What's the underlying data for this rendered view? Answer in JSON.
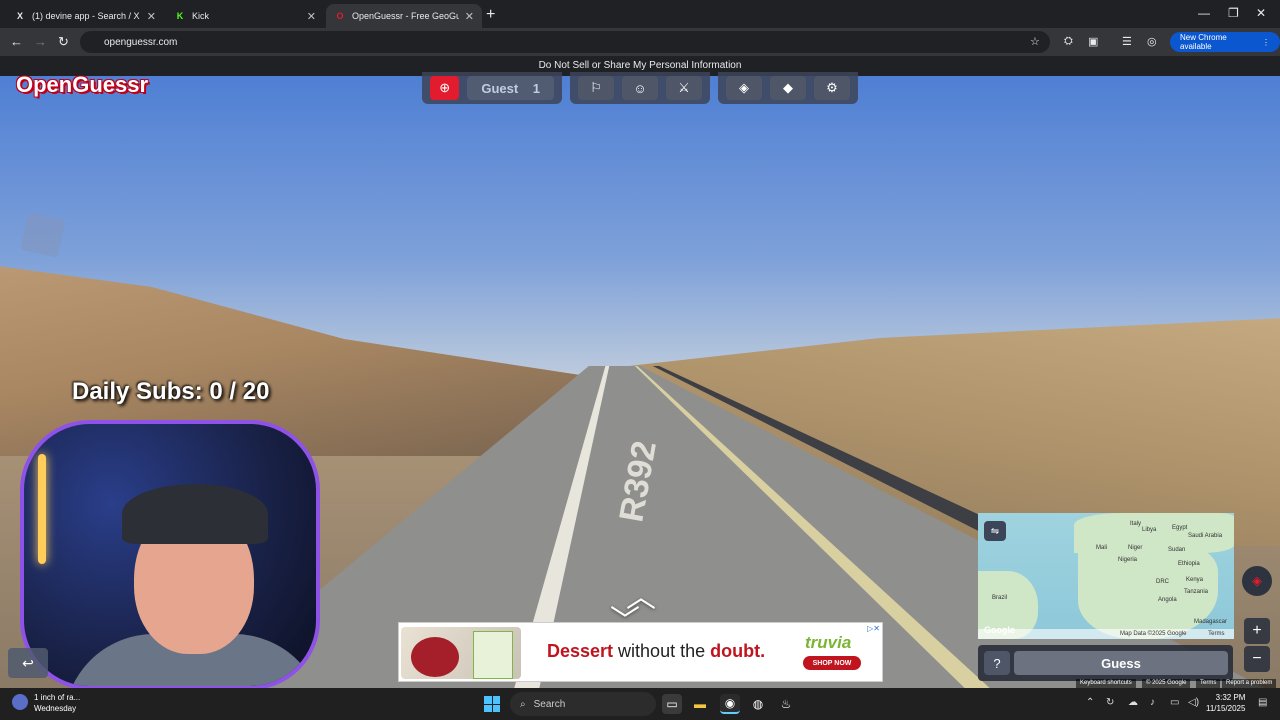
{
  "tabs": [
    {
      "icon": "X",
      "title": "(1) devine app - Search / X",
      "active": false
    },
    {
      "icon": "K",
      "title": "Kick",
      "active": false
    },
    {
      "icon": "O",
      "title": "OpenGuessr - Free GeoGuessr...",
      "active": true
    }
  ],
  "address": {
    "url": "openguessr.com"
  },
  "browser": {
    "new_chrome": "New Chrome available"
  },
  "notice": "Do Not Sell or Share My Personal Information",
  "site": {
    "logo": "OpenGuessr"
  },
  "toolbar": {
    "guest_label": "Guest",
    "guest_count": "1"
  },
  "overlay": {
    "daily_subs": "Daily Subs:  0 / 20"
  },
  "road_marking": "R392",
  "ad": {
    "headline_strong": "Dessert",
    "headline_rest": " without the ",
    "headline_end": "doubt.",
    "brand": "truvia",
    "cta": "SHOP NOW"
  },
  "map": {
    "labels": [
      "Italy",
      "Egypt",
      "Libya",
      "Saudi Arabia",
      "Mali",
      "Niger",
      "Sudan",
      "Nigeria",
      "Ethiopia",
      "DRC",
      "Kenya",
      "Brazil",
      "Angola",
      "Tanzania",
      "Madagascar"
    ],
    "attribution": "Map Data ©2025 Google",
    "terms": "Terms",
    "google": "Google"
  },
  "guess": {
    "help": "?",
    "button": "Guess"
  },
  "google_footer": {
    "shortcuts": "Keyboard shortcuts",
    "data": "© 2025 Google",
    "terms": "Terms",
    "report": "Report a problem"
  },
  "taskbar": {
    "weather_line1": "1 inch of ra...",
    "weather_line2": "Wednesday",
    "search": "Search",
    "time": "3:32 PM",
    "date": "11/15/2025"
  }
}
